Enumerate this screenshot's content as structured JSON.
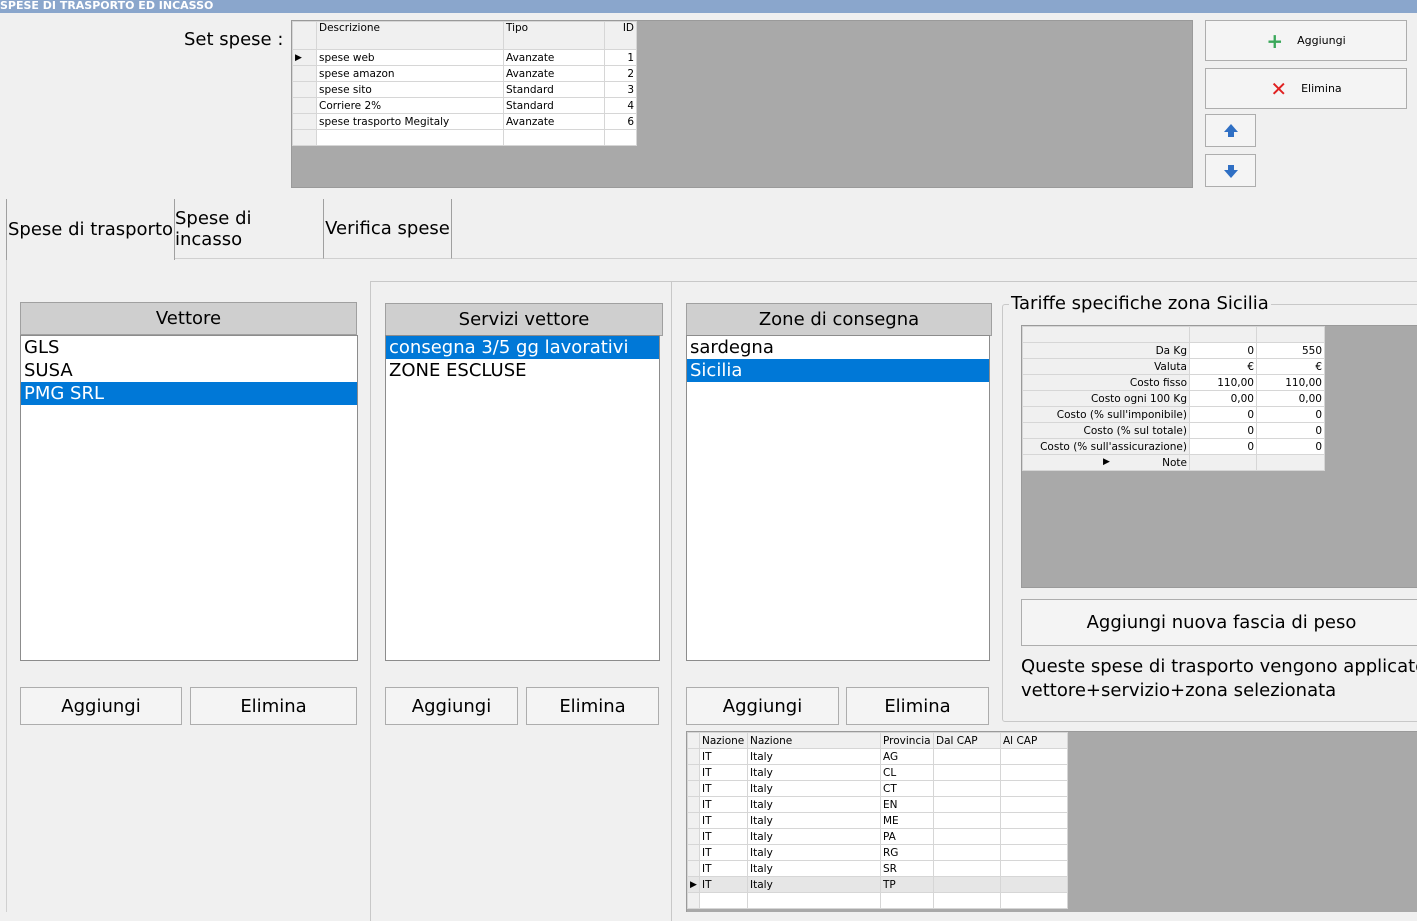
{
  "window": {
    "title": "SPESE DI TRASPORTO ED INCASSO"
  },
  "set_spese": {
    "label": "Set spese :",
    "columns": [
      "Descrizione",
      "Tipo",
      "ID"
    ],
    "rows": [
      {
        "descrizione": "spese web",
        "tipo": "Avanzate",
        "id": "1"
      },
      {
        "descrizione": "spese amazon",
        "tipo": "Avanzate",
        "id": "2"
      },
      {
        "descrizione": "spese sito",
        "tipo": "Standard",
        "id": "3"
      },
      {
        "descrizione": "Corriere 2%",
        "tipo": "Standard",
        "id": "4"
      },
      {
        "descrizione": "spese trasporto Megitaly",
        "tipo": "Avanzate",
        "id": "6"
      }
    ]
  },
  "toolbar": {
    "add_label": "Aggiungi",
    "delete_label": "Elimina",
    "add_color": "#3aa85a",
    "delete_color": "#e02020",
    "arrow_color": "#2f6fc4"
  },
  "tabs": [
    {
      "label": "Spese di trasporto",
      "active": true
    },
    {
      "label": "Spese di incasso",
      "active": false
    },
    {
      "label": "Verifica spese",
      "active": false
    }
  ],
  "vettore": {
    "header": "Vettore",
    "items": [
      "GLS",
      "SUSA",
      "PMG SRL"
    ],
    "selected": 2,
    "add_label": "Aggiungi",
    "delete_label": "Elimina"
  },
  "servizi": {
    "header": "Servizi vettore",
    "items": [
      "consegna 3/5 gg lavorativi",
      "ZONE ESCLUSE"
    ],
    "selected": 0,
    "add_label": "Aggiungi",
    "delete_label": "Elimina"
  },
  "zone": {
    "header": "Zone di consegna",
    "items": [
      "sardegna",
      "Sicilia"
    ],
    "selected": 1,
    "add_label": "Aggiungi",
    "delete_label": "Elimina",
    "columns": [
      "Nazione",
      "Nazione",
      "Provincia",
      "Dal CAP",
      "Al CAP"
    ],
    "rows": [
      {
        "code": "IT",
        "nazione": "Italy",
        "provincia": "AG"
      },
      {
        "code": "IT",
        "nazione": "Italy",
        "provincia": "CL"
      },
      {
        "code": "IT",
        "nazione": "Italy",
        "provincia": "CT"
      },
      {
        "code": "IT",
        "nazione": "Italy",
        "provincia": "EN"
      },
      {
        "code": "IT",
        "nazione": "Italy",
        "provincia": "ME"
      },
      {
        "code": "IT",
        "nazione": "Italy",
        "provincia": "PA"
      },
      {
        "code": "IT",
        "nazione": "Italy",
        "provincia": "RG"
      },
      {
        "code": "IT",
        "nazione": "Italy",
        "provincia": "SR"
      },
      {
        "code": "IT",
        "nazione": "Italy",
        "provincia": "TP"
      }
    ]
  },
  "tariffe": {
    "title": "Tariffe specifiche zona Sicilia",
    "rows": [
      {
        "label": "Da Kg",
        "c1": "0",
        "c2": "550"
      },
      {
        "label": "Valuta",
        "c1": "€",
        "c2": "€"
      },
      {
        "label": "Costo fisso",
        "c1": "110,00",
        "c2": "110,00"
      },
      {
        "label": "Costo ogni 100 Kg",
        "c1": "0,00",
        "c2": "0,00"
      },
      {
        "label": "Costo (% sull'imponibile)",
        "c1": "0",
        "c2": "0"
      },
      {
        "label": "Costo (% sul totale)",
        "c1": "0",
        "c2": "0"
      },
      {
        "label": "Costo (% sull'assicurazione)",
        "c1": "0",
        "c2": "0"
      },
      {
        "label": "Note",
        "c1": "",
        "c2": ""
      }
    ],
    "add_band_label": "Aggiungi nuova fascia di peso",
    "info_line1": "Queste spese di trasporto vengono applicate es",
    "info_line2": "vettore+servizio+zona selezionata"
  }
}
